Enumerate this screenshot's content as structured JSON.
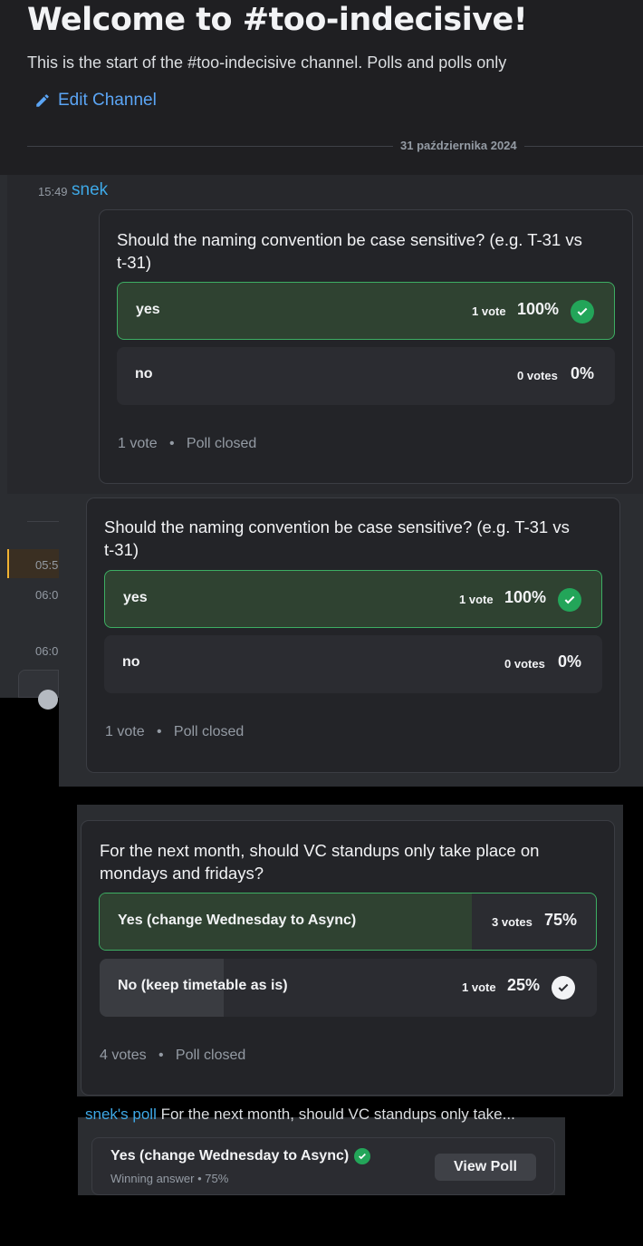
{
  "channel": {
    "welcome_title": "Welcome to #too-indecisive!",
    "description": "This is the start of the #too-indecisive channel. Polls and polls only",
    "edit_label": "Edit Channel",
    "date": "31 października 2024"
  },
  "message": {
    "time": "15:49",
    "author": "snek"
  },
  "poll1": {
    "question": "Should the naming convention be case sensitive? (e.g. T-31 vs t-31)",
    "answers": [
      {
        "label": "yes",
        "votes": "1 vote",
        "pct": "100%",
        "fraction": 1.0,
        "winner": true
      },
      {
        "label": "no",
        "votes": "0 votes",
        "pct": "0%",
        "fraction": 0.0,
        "winner": false
      }
    ],
    "total": "1 vote",
    "status": "Poll closed"
  },
  "side_times": [
    "05:5",
    "06:0",
    "06:0"
  ],
  "poll2": {
    "question": "For the next month, should VC standups only take place on mondays and fridays?",
    "answers": [
      {
        "label": "Yes (change Wednesday to Async)",
        "votes": "3 votes",
        "pct": "75%",
        "fraction": 0.75,
        "winner": true
      },
      {
        "label": "No (keep timetable as is)",
        "votes": "1 vote",
        "pct": "25%",
        "fraction": 0.25,
        "winner": false,
        "selected": true
      }
    ],
    "total": "4 votes",
    "status": "Poll closed"
  },
  "poll_result": {
    "partial_author": "snek's poll",
    "partial_question": "For the next month, should VC standups only take...",
    "winning_answer": "Yes (change Wednesday to Async)",
    "subtitle": "Winning answer • 75%",
    "view_label": "View Poll"
  },
  "colors": {
    "accent_blue": "#5ba5f5",
    "winner_green": "#23a559",
    "author_blue": "#3ea8e6"
  }
}
